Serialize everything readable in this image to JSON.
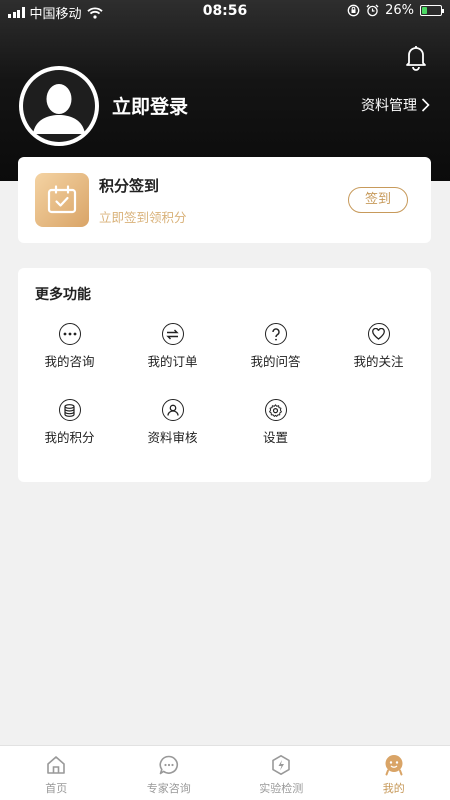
{
  "status_bar": {
    "carrier": "中国移动",
    "time": "08:56",
    "battery": "26%",
    "battery_level": 0.26
  },
  "header": {
    "login_label": "立即登录",
    "profile_manage_label": "资料管理"
  },
  "sign_in": {
    "title": "积分签到",
    "subtitle": "立即签到领积分",
    "button_label": "签到"
  },
  "more": {
    "title": "更多功能",
    "items": [
      {
        "label": "我的咨询",
        "icon": "more-dots-icon"
      },
      {
        "label": "我的订单",
        "icon": "exchange-icon"
      },
      {
        "label": "我的问答",
        "icon": "question-icon"
      },
      {
        "label": "我的关注",
        "icon": "heart-icon"
      },
      {
        "label": "我的积分",
        "icon": "coins-icon"
      },
      {
        "label": "资料审核",
        "icon": "user-icon"
      },
      {
        "label": "设置",
        "icon": "gear-icon"
      }
    ]
  },
  "tabbar": {
    "items": [
      {
        "label": "首页",
        "icon": "home-icon"
      },
      {
        "label": "专家咨询",
        "icon": "chat-icon"
      },
      {
        "label": "实验检测",
        "icon": "lightning-icon"
      },
      {
        "label": "我的",
        "icon": "me-icon"
      }
    ],
    "active_index": 3
  },
  "colors": {
    "accent": "#c79a5b",
    "accent_light": "#d9b27a",
    "header_dark": "#0b0b0b",
    "background": "#f1f1f1"
  }
}
